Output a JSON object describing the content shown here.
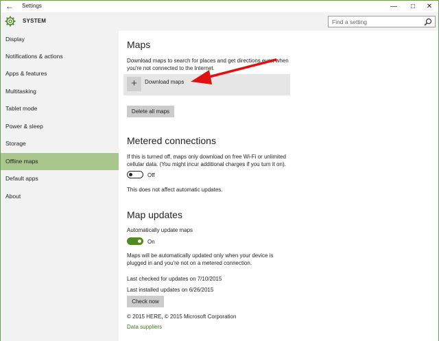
{
  "window": {
    "title": "Settings",
    "back_icon": "back-arrow-icon",
    "controls": [
      "minimize-icon",
      "maximize-icon",
      "close-icon"
    ],
    "accent_color": "#4f8a24",
    "selection_color": "#a9c68c"
  },
  "header": {
    "section": "SYSTEM",
    "icon": "gear-icon",
    "search_placeholder": "Find a setting"
  },
  "sidebar": {
    "items": [
      {
        "label": "Display",
        "selected": false
      },
      {
        "label": "Notifications & actions",
        "selected": false
      },
      {
        "label": "Apps & features",
        "selected": false
      },
      {
        "label": "Multitasking",
        "selected": false
      },
      {
        "label": "Tablet mode",
        "selected": false
      },
      {
        "label": "Power & sleep",
        "selected": false
      },
      {
        "label": "Storage",
        "selected": false
      },
      {
        "label": "Offline maps",
        "selected": true
      },
      {
        "label": "Default apps",
        "selected": false
      },
      {
        "label": "About",
        "selected": false
      }
    ]
  },
  "main": {
    "maps": {
      "heading": "Maps",
      "description_line1": "Download maps to search for places and get directions even when",
      "description_line2": "you're not connected to the Internet.",
      "download_label": "Download maps",
      "delete_label": "Delete all maps"
    },
    "metered": {
      "heading": "Metered connections",
      "description_line1": "If this is turned off, maps only download on free Wi-Fi or unlimited",
      "description_line2": "cellular data. (You might incur additional charges if you turn it on).",
      "toggle_state": "Off",
      "note": "This does not affect automatic updates."
    },
    "updates": {
      "heading": "Map updates",
      "auto_label": "Automatically update maps",
      "toggle_state": "On",
      "description_line1": "Maps will be automatically updated only when your device is",
      "description_line2": "plugged in and you're not on a metered connection.",
      "last_checked": "Last checked for updates on 7/10/2015",
      "last_installed": "Last installed updates on 6/26/2015",
      "check_now_label": "Check now",
      "copyright": "© 2015 HERE, © 2015 Microsoft Corporation",
      "suppliers_link": "Data suppliers"
    }
  },
  "annotation": {
    "arrow_color": "#e01010"
  }
}
